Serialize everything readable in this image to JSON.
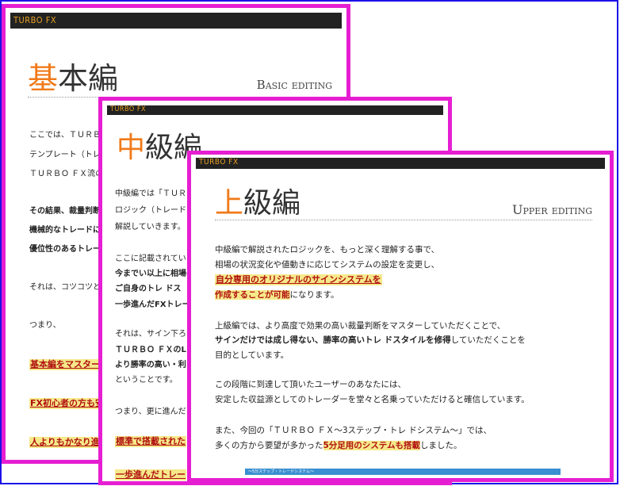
{
  "basic": {
    "bar_label": "TURBO FX",
    "title_first": "基",
    "title_rest": "本編",
    "subtitle": "Basic editing",
    "lines": [
      "ここでは、ＴＵＲＢＯ",
      "テンプレート（トレー",
      "ＴＵＲＢＯ ＦＸ流の",
      "その結果、裁量判断を",
      "機械的なトレードによ",
      "優位性のあるトレード",
      "それは、コツコツと利",
      "つまり、"
    ],
    "highlights": [
      "基本編をマスターし",
      "FX初心者の方も安",
      "人よりもかなり進ん"
    ]
  },
  "intermediate": {
    "bar_label": "TURBO FX",
    "title_first": "中",
    "title_rest": "級編",
    "lines": [
      "中級編では「ＴＵＲ",
      "ロジック（トレード",
      "解説していきます。",
      "ここに記載されてい",
      "今までい以上に相場の",
      "ご自身のトレ ドス",
      "一歩進んだFXトレー",
      "それは、サイン下ろ",
      "ＴＵＲＢＯ ＦＸのL",
      "より勝率の高い・利",
      "ということです。",
      "つまり、更に進んだ"
    ],
    "highlights": [
      "標準で搭載された",
      "一歩進んだトレー"
    ]
  },
  "upper": {
    "bar_label": "TURBO FX",
    "title_first": "上",
    "title_rest": "級編",
    "subtitle": "Upper editing",
    "para1": [
      "中級編で解説されたロジックを、もっと深く理解する事で、",
      "相場の状況変化や値動きに応じてシステムの設定を変更し、"
    ],
    "para1_hl1": "自分専用のオリジナルのサインシステムを",
    "para1_hl2": "作成することが可能",
    "para1_tail": "になります。",
    "para2": [
      "上級編では、より高度で効果の高い裁量判断をマスターしていただくことで、"
    ],
    "para2_bold": "サインだけでは成し得ない、勝率の高いトレ ドスタイルを修得",
    "para2_bold_tail": "していただくことを",
    "para2_end": "目的としています。",
    "para3": [
      "この段階に到達して頂いたユーザーのあなたには、",
      "安定した収益源としてのトレーダーを堂々と名乗っていただけると確信しています。"
    ],
    "para4_1": "また、今回の「ＴＵＲＢＯ ＦＸ～3ステップ・トレ ドシステム～」では、",
    "para4_2_pre": "多くの方から要望が多かった",
    "para4_2_hl": "5分足用のシステムも搭載",
    "para4_2_tail": "しました。",
    "footer_label": "～5分ステップ・トレードシステム～"
  }
}
